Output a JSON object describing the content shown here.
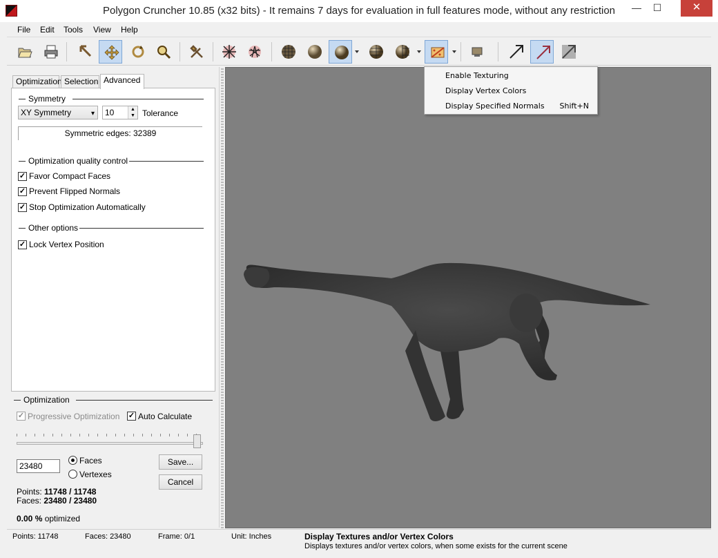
{
  "window": {
    "title": "Polygon Cruncher 10.85 (x32 bits) - It remains 7 days for evaluation in full features mode, without any restriction",
    "minimize_glyph": "—",
    "maximize_glyph": "☐",
    "close_glyph": "✕"
  },
  "menu": [
    "File",
    "Edit",
    "Tools",
    "View",
    "Help"
  ],
  "toolbar": {
    "icons": [
      "open-folder-icon",
      "print-icon",
      "select-arrow-icon",
      "move-icon",
      "rotate-icon",
      "zoom-icon",
      "tools-hammer-icon",
      "wireframe-cross-icon",
      "star-cross-icon",
      "wire-sphere-icon",
      "flat-sphere-icon",
      "smooth-sphere-icon",
      "shaded-wire-sphere-icon",
      "half-sphere-icon",
      "texture-icon",
      "camera-icon",
      "normals-arrow-icon",
      "normals-arrow-selected-icon",
      "normals-arrow-grey-icon"
    ]
  },
  "tabs": [
    "Optimization",
    "Selection",
    "Advanced"
  ],
  "advanced": {
    "symmetry_heading": "Symmetry",
    "symmetry_mode": "XY Symmetry",
    "tolerance_value": "10",
    "tolerance_label": "Tolerance",
    "symmetric_edges": "Symmetric edges: 32389",
    "quality_heading": "Optimization quality control",
    "quality_options": [
      {
        "label": "Favor Compact Faces",
        "checked": true
      },
      {
        "label": "Prevent Flipped Normals",
        "checked": true
      },
      {
        "label": "Stop Optimization Automatically",
        "checked": true
      }
    ],
    "other_heading": "Other options",
    "other_options": [
      {
        "label": "Lock Vertex Position",
        "checked": true
      }
    ]
  },
  "optimization": {
    "heading": "Optimization",
    "progressive_label": "Progressive Optimization",
    "progressive_checked": true,
    "auto_calc_label": "Auto Calculate",
    "auto_calc_checked": true,
    "slider_fraction": 1.0,
    "count_value": "23480",
    "faces_label": "Faces",
    "vertexes_label": "Vertexes",
    "save_label": "Save...",
    "cancel_label": "Cancel",
    "points_label": "Points:",
    "points_value": "11748 / 11748",
    "faces_stat_label": "Faces:",
    "faces_value": "23480 / 23480",
    "percent_value": "0.00 %",
    "percent_label": "optimized"
  },
  "dropdown": {
    "items": [
      {
        "label": "Enable Texturing",
        "shortcut": ""
      },
      {
        "label": "Display Vertex Colors",
        "shortcut": ""
      },
      {
        "label": "Display Specified Normals",
        "shortcut": "Shift+N"
      }
    ]
  },
  "status": {
    "points": "Points: 11748",
    "faces": "Faces: 23480",
    "frame": "Frame: 0/1",
    "unit": "Unit: Inches",
    "hint_title": "Display Textures and/or Vertex Colors",
    "hint_text": "Displays textures and/or vertex colors, when some exists for the current scene"
  },
  "colors": {
    "viewport_bg": "#808080",
    "model": "#3c3c3c",
    "active_tool": "#c5daf2",
    "close_button": "#c7413a"
  }
}
